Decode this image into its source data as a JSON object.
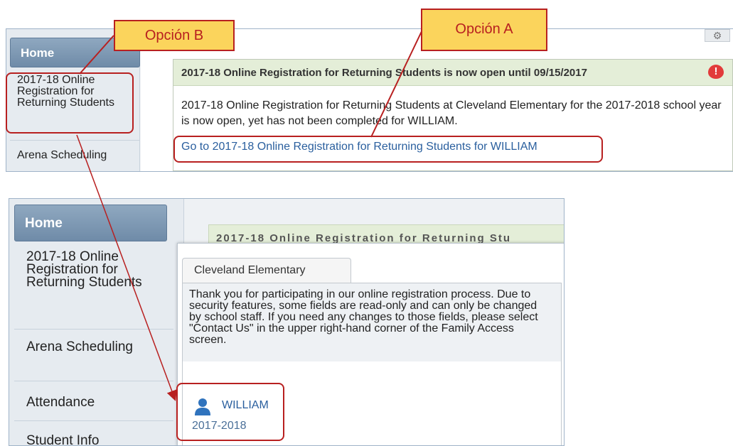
{
  "top": {
    "home": "Home",
    "sidebar_item_1": "2017-18 Online Registration for Returning Students",
    "sidebar_item_2": "Arena Scheduling",
    "alert_title": "2017-18 Online Registration for Returning Students is now open until 09/15/2017",
    "alert_body": "2017-18 Online Registration for Returning Students at Cleveland Elementary for the 2017-2018 school year is now open, yet has not been completed for WILLIAM.",
    "alert_link": "Go to 2017-18 Online Registration for Returning Students for WILLIAM",
    "warning_icon": "exclamation-icon"
  },
  "bottom": {
    "home": "Home",
    "sidebar_items": [
      "2017-18 Online Registration for Returning Students",
      "Arena Scheduling",
      "Attendance",
      "Student Info"
    ],
    "behind_title": "2017-18 Online Registration for Returning Stu",
    "popup_tab": "Cleveland Elementary",
    "popup_text": "Thank you for participating in our online registration process. Due to security features, some fields are read-only and can only be changed by school staff. If you need any changes to those fields, please select \"Contact Us\" in the upper right-hand corner of the Family Access screen.",
    "student_name": "WILLIAM",
    "student_year": "2017-2018",
    "student_icon": "person-icon"
  },
  "callouts": {
    "option_b": "Opción B",
    "option_a": "Opción A"
  },
  "colors": {
    "callout_fill": "#fbd45c",
    "callout_border": "#b82020",
    "link": "#2a5f9e",
    "nav_home": "#7f99b4"
  }
}
